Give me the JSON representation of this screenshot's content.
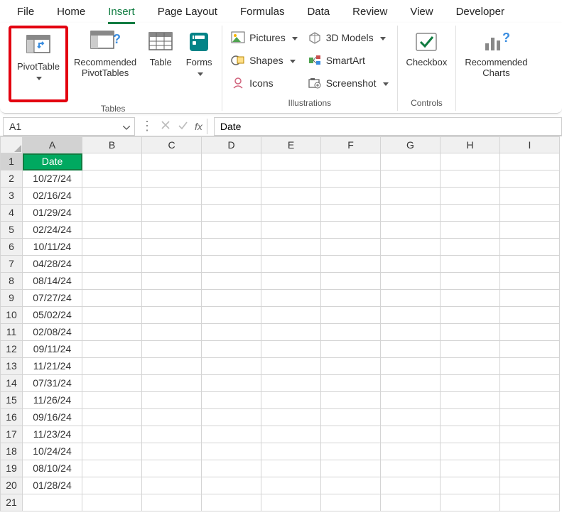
{
  "tabs": {
    "file": "File",
    "home": "Home",
    "insert": "Insert",
    "pagelayout": "Page Layout",
    "formulas": "Formulas",
    "data": "Data",
    "review": "Review",
    "view": "View",
    "developer": "Developer"
  },
  "ribbon": {
    "pivot": "PivotTable",
    "recpivot_l1": "Recommended",
    "recpivot_l2": "PivotTables",
    "table": "Table",
    "forms": "Forms",
    "pictures": "Pictures",
    "shapes": "Shapes",
    "icons": "Icons",
    "models": "3D Models",
    "smartart": "SmartArt",
    "screenshot": "Screenshot",
    "checkbox": "Checkbox",
    "reccharts_l1": "Recommended",
    "reccharts_l2": "Charts",
    "group_tables": "Tables",
    "group_illus": "Illustrations",
    "group_controls": "Controls"
  },
  "namebox": "A1",
  "fx_label": "fx",
  "formula": "Date",
  "columns": [
    "A",
    "B",
    "C",
    "D",
    "E",
    "F",
    "G",
    "H",
    "I"
  ],
  "rows": [
    {
      "n": 1,
      "a": "Date",
      "header": true,
      "active": true
    },
    {
      "n": 2,
      "a": "10/27/24"
    },
    {
      "n": 3,
      "a": "02/16/24"
    },
    {
      "n": 4,
      "a": "01/29/24"
    },
    {
      "n": 5,
      "a": "02/24/24"
    },
    {
      "n": 6,
      "a": "10/11/24"
    },
    {
      "n": 7,
      "a": "04/28/24"
    },
    {
      "n": 8,
      "a": "08/14/24"
    },
    {
      "n": 9,
      "a": "07/27/24"
    },
    {
      "n": 10,
      "a": "05/02/24"
    },
    {
      "n": 11,
      "a": "02/08/24"
    },
    {
      "n": 12,
      "a": "09/11/24"
    },
    {
      "n": 13,
      "a": "11/21/24"
    },
    {
      "n": 14,
      "a": "07/31/24"
    },
    {
      "n": 15,
      "a": "11/26/24"
    },
    {
      "n": 16,
      "a": "09/16/24"
    },
    {
      "n": 17,
      "a": "11/23/24"
    },
    {
      "n": 18,
      "a": "10/24/24"
    },
    {
      "n": 19,
      "a": "08/10/24"
    },
    {
      "n": 20,
      "a": "01/28/24"
    },
    {
      "n": 21,
      "a": ""
    }
  ]
}
